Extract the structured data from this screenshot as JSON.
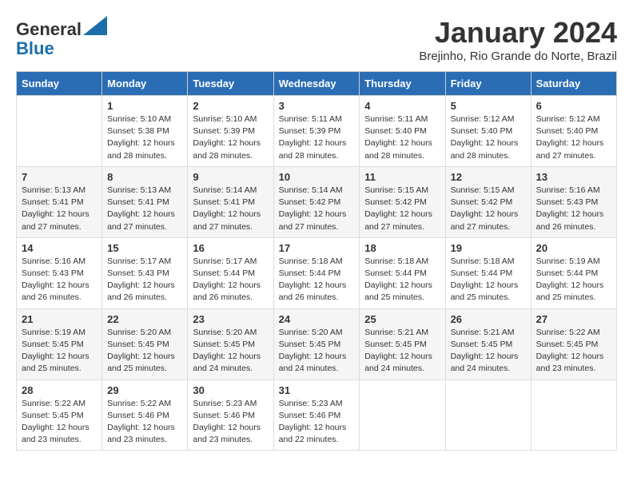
{
  "logo": {
    "line1": "General",
    "line2": "Blue"
  },
  "title": "January 2024",
  "location": "Brejinho, Rio Grande do Norte, Brazil",
  "days_of_week": [
    "Sunday",
    "Monday",
    "Tuesday",
    "Wednesday",
    "Thursday",
    "Friday",
    "Saturday"
  ],
  "weeks": [
    [
      {
        "day": "",
        "info": ""
      },
      {
        "day": "1",
        "info": "Sunrise: 5:10 AM\nSunset: 5:38 PM\nDaylight: 12 hours\nand 28 minutes."
      },
      {
        "day": "2",
        "info": "Sunrise: 5:10 AM\nSunset: 5:39 PM\nDaylight: 12 hours\nand 28 minutes."
      },
      {
        "day": "3",
        "info": "Sunrise: 5:11 AM\nSunset: 5:39 PM\nDaylight: 12 hours\nand 28 minutes."
      },
      {
        "day": "4",
        "info": "Sunrise: 5:11 AM\nSunset: 5:40 PM\nDaylight: 12 hours\nand 28 minutes."
      },
      {
        "day": "5",
        "info": "Sunrise: 5:12 AM\nSunset: 5:40 PM\nDaylight: 12 hours\nand 28 minutes."
      },
      {
        "day": "6",
        "info": "Sunrise: 5:12 AM\nSunset: 5:40 PM\nDaylight: 12 hours\nand 27 minutes."
      }
    ],
    [
      {
        "day": "7",
        "info": "Sunrise: 5:13 AM\nSunset: 5:41 PM\nDaylight: 12 hours\nand 27 minutes."
      },
      {
        "day": "8",
        "info": "Sunrise: 5:13 AM\nSunset: 5:41 PM\nDaylight: 12 hours\nand 27 minutes."
      },
      {
        "day": "9",
        "info": "Sunrise: 5:14 AM\nSunset: 5:41 PM\nDaylight: 12 hours\nand 27 minutes."
      },
      {
        "day": "10",
        "info": "Sunrise: 5:14 AM\nSunset: 5:42 PM\nDaylight: 12 hours\nand 27 minutes."
      },
      {
        "day": "11",
        "info": "Sunrise: 5:15 AM\nSunset: 5:42 PM\nDaylight: 12 hours\nand 27 minutes."
      },
      {
        "day": "12",
        "info": "Sunrise: 5:15 AM\nSunset: 5:42 PM\nDaylight: 12 hours\nand 27 minutes."
      },
      {
        "day": "13",
        "info": "Sunrise: 5:16 AM\nSunset: 5:43 PM\nDaylight: 12 hours\nand 26 minutes."
      }
    ],
    [
      {
        "day": "14",
        "info": "Sunrise: 5:16 AM\nSunset: 5:43 PM\nDaylight: 12 hours\nand 26 minutes."
      },
      {
        "day": "15",
        "info": "Sunrise: 5:17 AM\nSunset: 5:43 PM\nDaylight: 12 hours\nand 26 minutes."
      },
      {
        "day": "16",
        "info": "Sunrise: 5:17 AM\nSunset: 5:44 PM\nDaylight: 12 hours\nand 26 minutes."
      },
      {
        "day": "17",
        "info": "Sunrise: 5:18 AM\nSunset: 5:44 PM\nDaylight: 12 hours\nand 26 minutes."
      },
      {
        "day": "18",
        "info": "Sunrise: 5:18 AM\nSunset: 5:44 PM\nDaylight: 12 hours\nand 25 minutes."
      },
      {
        "day": "19",
        "info": "Sunrise: 5:18 AM\nSunset: 5:44 PM\nDaylight: 12 hours\nand 25 minutes."
      },
      {
        "day": "20",
        "info": "Sunrise: 5:19 AM\nSunset: 5:44 PM\nDaylight: 12 hours\nand 25 minutes."
      }
    ],
    [
      {
        "day": "21",
        "info": "Sunrise: 5:19 AM\nSunset: 5:45 PM\nDaylight: 12 hours\nand 25 minutes."
      },
      {
        "day": "22",
        "info": "Sunrise: 5:20 AM\nSunset: 5:45 PM\nDaylight: 12 hours\nand 25 minutes."
      },
      {
        "day": "23",
        "info": "Sunrise: 5:20 AM\nSunset: 5:45 PM\nDaylight: 12 hours\nand 24 minutes."
      },
      {
        "day": "24",
        "info": "Sunrise: 5:20 AM\nSunset: 5:45 PM\nDaylight: 12 hours\nand 24 minutes."
      },
      {
        "day": "25",
        "info": "Sunrise: 5:21 AM\nSunset: 5:45 PM\nDaylight: 12 hours\nand 24 minutes."
      },
      {
        "day": "26",
        "info": "Sunrise: 5:21 AM\nSunset: 5:45 PM\nDaylight: 12 hours\nand 24 minutes."
      },
      {
        "day": "27",
        "info": "Sunrise: 5:22 AM\nSunset: 5:45 PM\nDaylight: 12 hours\nand 23 minutes."
      }
    ],
    [
      {
        "day": "28",
        "info": "Sunrise: 5:22 AM\nSunset: 5:45 PM\nDaylight: 12 hours\nand 23 minutes."
      },
      {
        "day": "29",
        "info": "Sunrise: 5:22 AM\nSunset: 5:46 PM\nDaylight: 12 hours\nand 23 minutes."
      },
      {
        "day": "30",
        "info": "Sunrise: 5:23 AM\nSunset: 5:46 PM\nDaylight: 12 hours\nand 23 minutes."
      },
      {
        "day": "31",
        "info": "Sunrise: 5:23 AM\nSunset: 5:46 PM\nDaylight: 12 hours\nand 22 minutes."
      },
      {
        "day": "",
        "info": ""
      },
      {
        "day": "",
        "info": ""
      },
      {
        "day": "",
        "info": ""
      }
    ]
  ]
}
